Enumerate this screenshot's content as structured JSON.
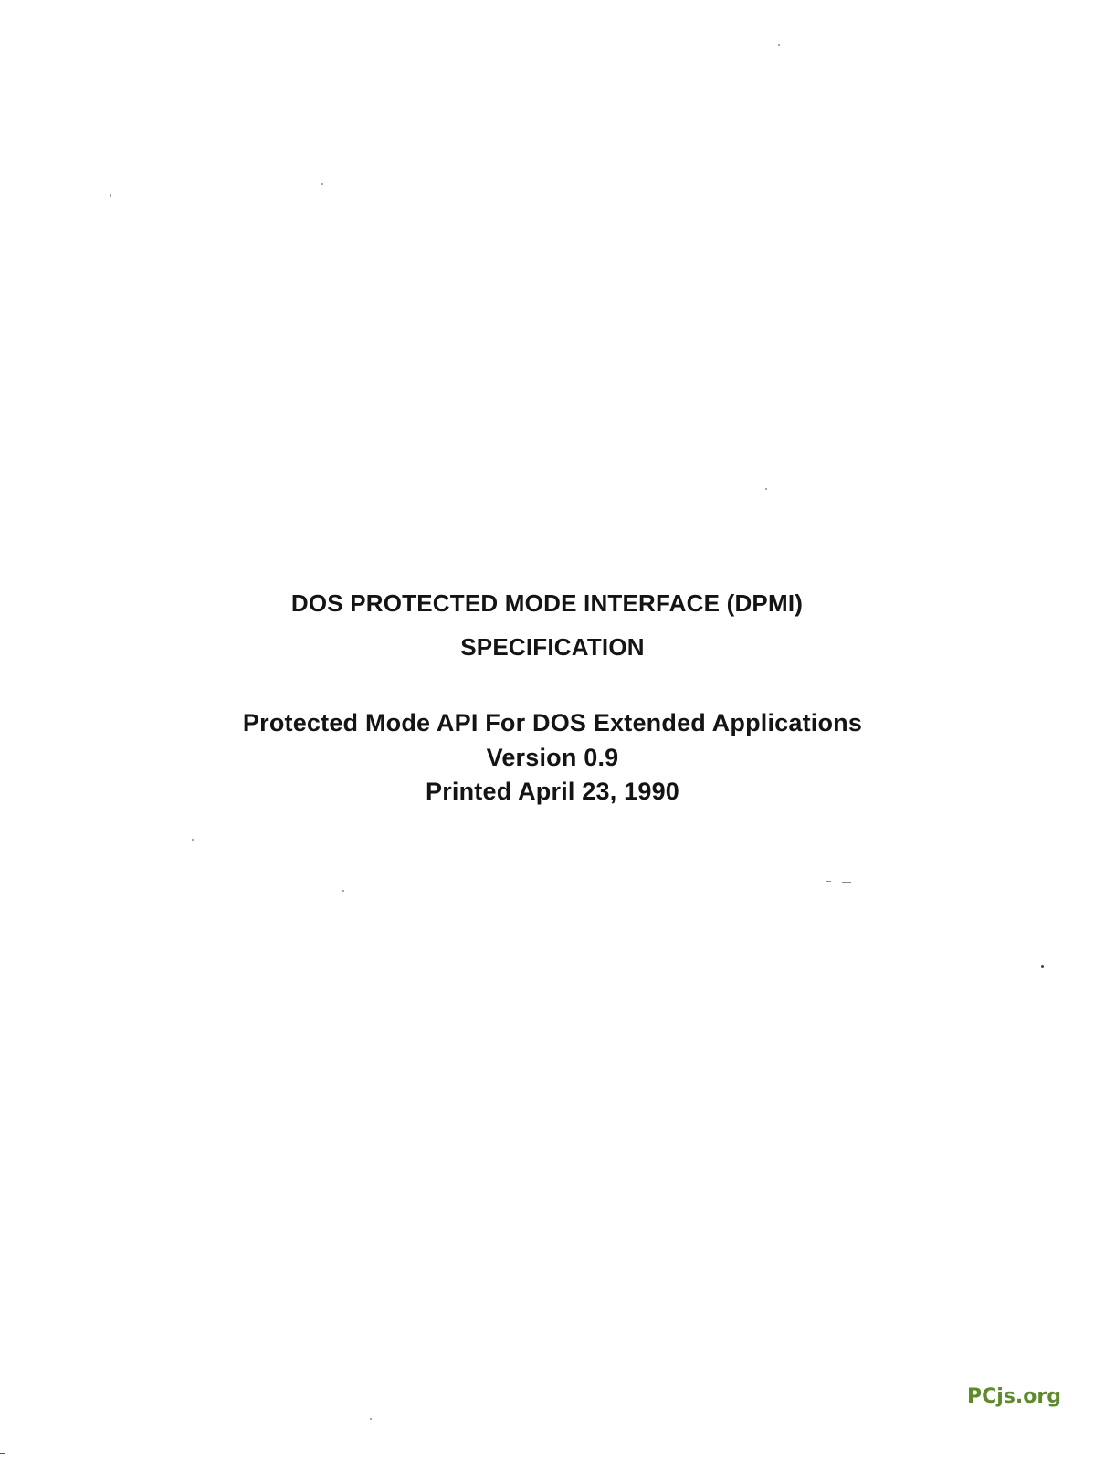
{
  "document": {
    "title_line1": "DOS PROTECTED MODE INTERFACE (DPMI)",
    "title_line2": "SPECIFICATION",
    "subtitle": "Protected Mode API For DOS Extended Applications",
    "version": "Version 0.9",
    "printed_date": "Printed April 23, 1990"
  },
  "watermark": {
    "text": "PCjs.org",
    "color": "#5e8a2d"
  }
}
